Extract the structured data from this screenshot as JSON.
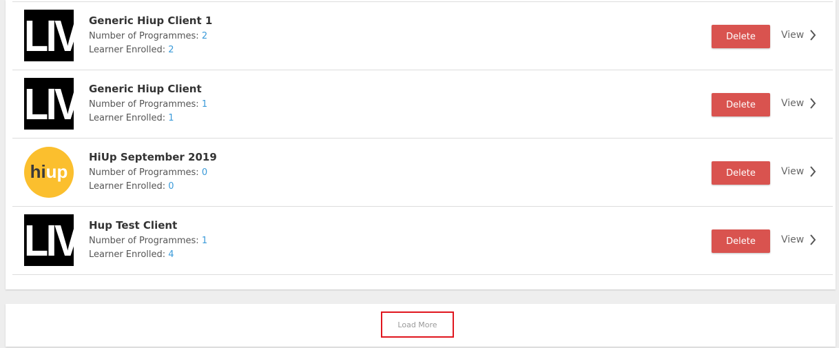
{
  "clients": [
    {
      "name": "Generic Hiup Client 1",
      "logo": "LIV",
      "programmes_label": "Number of Programmes: ",
      "programmes": "2",
      "learners_label": "Learner Enrolled: ",
      "learners": "2",
      "delete_label": "Delete",
      "view_label": "View"
    },
    {
      "name": "Generic Hiup Client",
      "logo": "LIV",
      "programmes_label": "Number of Programmes: ",
      "programmes": "1",
      "learners_label": "Learner Enrolled: ",
      "learners": "1",
      "delete_label": "Delete",
      "view_label": "View"
    },
    {
      "name": "HiUp September 2019",
      "logo_hi": "hi",
      "logo_up": "up",
      "programmes_label": "Number of Programmes: ",
      "programmes": "0",
      "learners_label": "Learner Enrolled: ",
      "learners": "0",
      "delete_label": "Delete",
      "view_label": "View"
    },
    {
      "name": "Hup Test Client",
      "logo": "LIV",
      "programmes_label": "Number of Programmes: ",
      "programmes": "1",
      "learners_label": "Learner Enrolled: ",
      "learners": "4",
      "delete_label": "Delete",
      "view_label": "View"
    }
  ],
  "load_more_label": "Load More",
  "colors": {
    "delete": "#d9534f",
    "link_value": "#3a9ad9",
    "highlight": "#e0151d",
    "hiup_logo": "#fbbf2e"
  }
}
